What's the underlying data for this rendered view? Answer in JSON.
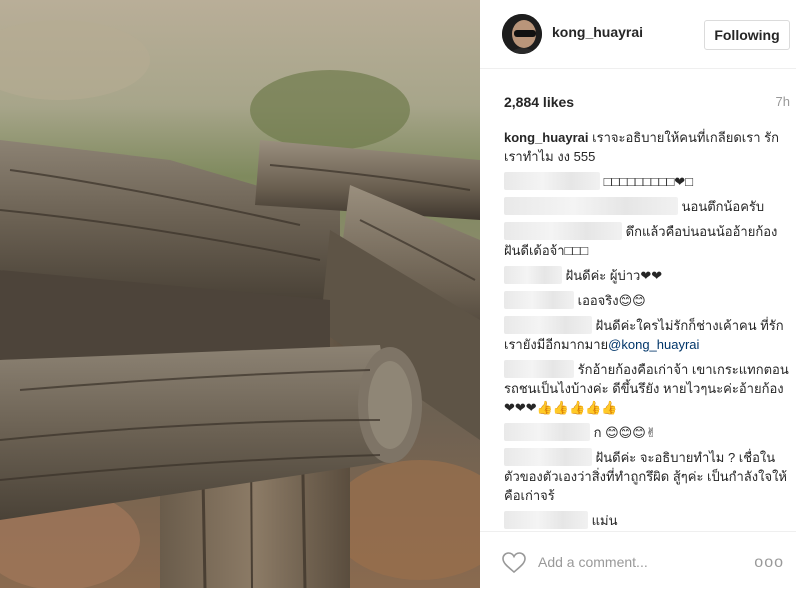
{
  "post": {
    "photo_alt": "weathered wooden logs",
    "username": "kong_huayrai",
    "follow_button": "Following",
    "likes": "2,884 likes",
    "time": "7h",
    "caption_user": "kong_huayrai",
    "caption_text": "เราจะอธิบายให้คนที่เกลียดเรา รักเราทำไม งง 555"
  },
  "comments": [
    {
      "text": "□□□□□□□□□❤︎□"
    },
    {
      "text": "นอนตึกน้อครับ"
    },
    {
      "text": "ดึกแล้วคือบ่นอนน้ออ้ายก้อง ฝันดีเด้อจ้า□□□"
    },
    {
      "text": "ฝันดีค่ะ ผู้บ่าว❤︎❤︎"
    },
    {
      "text": "เออจริง😊😊"
    },
    {
      "text": "ฝันดีค่ะใครไม่รักก็ช่างเค้าคน ที่รักเรายังมีอีกมากมาย",
      "mention": "@kong_huayrai"
    },
    {
      "text": "รักอ้ายก้องคือเก่าจ้า เขาเกระแทกตอนรถชนเป็นไงบ้างค่ะ ดีขึ้นรึยัง หายไวๆนะค่ะอ้ายก้อง ❤︎❤︎❤︎👍👍👍👍👍"
    },
    {
      "text": "ก 😊😊😊✌"
    },
    {
      "text": "ฝันดีค่ะ จะอธิบายทำไม ? เชื่อในตัวของตัวเองว่าสิ่งที่ทำถูกรึผิด สู้ๆค่ะ เป็นกำลังใจให้คือเก่าจร้"
    },
    {
      "text": "แม่น"
    }
  ],
  "add_comment": {
    "placeholder": "Add a comment...",
    "more": "ooo"
  }
}
